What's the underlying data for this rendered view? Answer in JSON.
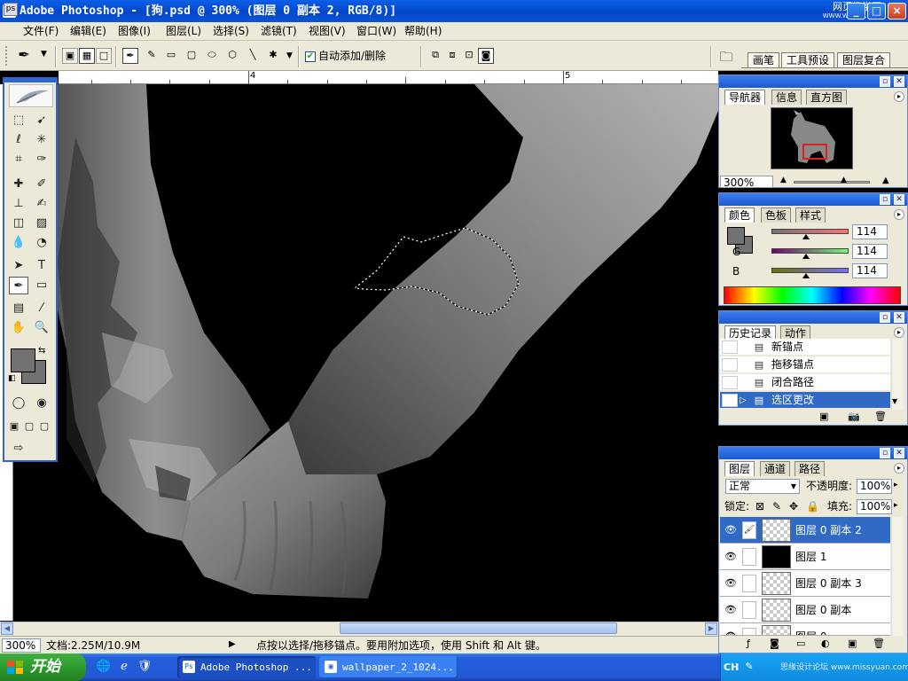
{
  "window": {
    "title": "Adobe Photoshop - [狗.psd @ 300% (图层 0 副本 2, RGB/8)]",
    "logo_text": "Ps",
    "watermark_line1": "网页教学网",
    "watermark_line2": "WWW.WEB3X.COM",
    "btn_min": "_",
    "btn_max": "□",
    "btn_close": "×"
  },
  "menu": {
    "items": [
      "文件(F)",
      "编辑(E)",
      "图像(I)",
      "图层(L)",
      "选择(S)",
      "滤镜(T)",
      "视图(V)",
      "窗口(W)",
      "帮助(H)"
    ]
  },
  "options": {
    "auto_add_delete_label": "自动添加/删除",
    "auto_add_delete_checked": true,
    "well_tabs": [
      "画笔",
      "工具预设",
      "图层复合"
    ]
  },
  "rulers": {
    "top_labels": [
      "4",
      "5"
    ]
  },
  "status": {
    "zoom": "300%",
    "doc_info": "文档:2.25M/10.9M",
    "message": "点按以选择/拖移锚点。要用附加选项，使用 Shift 和 Alt 键。"
  },
  "navigator": {
    "tabs": [
      "导航器",
      "信息",
      "直方图"
    ],
    "zoom": "300%"
  },
  "color": {
    "tabs": [
      "颜色",
      "色板",
      "样式"
    ],
    "channels": [
      {
        "label": "R",
        "value": "114"
      },
      {
        "label": "G",
        "value": "114"
      },
      {
        "label": "B",
        "value": "114"
      }
    ],
    "foreground": "#727272",
    "background": "#727272"
  },
  "history": {
    "tabs": [
      "历史记录",
      "动作"
    ],
    "items": [
      "新锚点",
      "拖移锚点",
      "闭合路径",
      "选区更改"
    ],
    "selected_index": 3
  },
  "layers": {
    "tabs": [
      "图层",
      "通道",
      "路径"
    ],
    "blend_mode": "正常",
    "opacity_label": "不透明度:",
    "opacity": "100%",
    "lock_label": "锁定:",
    "fill_label": "填充:",
    "fill": "100%",
    "items": [
      {
        "name": "图层 0 副本 2",
        "selected": true
      },
      {
        "name": "图层 1",
        "selected": false
      },
      {
        "name": "图层 0 副本 3",
        "selected": false
      },
      {
        "name": "图层 0 副本",
        "selected": false
      },
      {
        "name": "图层 0",
        "selected": false
      }
    ]
  },
  "taskbar": {
    "start_label": "开始",
    "tasks": [
      {
        "label": "Adobe Photoshop ...",
        "active": true
      },
      {
        "label": "wallpaper_2_1024...",
        "active": false
      }
    ],
    "lang": "CH",
    "tray_watermark": "思缘设计论坛 www.missyuan.com"
  },
  "icons": {
    "accent": "#316ac5",
    "titlebar": "#0446c8"
  }
}
